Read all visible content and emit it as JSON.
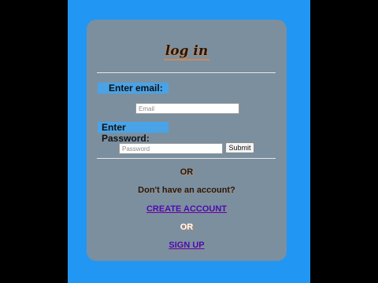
{
  "login_form": {
    "title": "log in",
    "email_label": "Enter email:",
    "email_placeholder": "Email",
    "password_label": "Enter Password:",
    "password_placeholder": "Password",
    "submit_label": "Submit",
    "or_text_1": "OR",
    "no_account_text": "Don't have an account?",
    "create_account_link": "CREATE ACCOUNT",
    "or_text_2": "OR",
    "sign_up_link": "SIGN UP"
  },
  "colors": {
    "page_background": "#2196f3",
    "card_background": "#7b8f9f",
    "label_background": "#4aa3e6",
    "link": "#3a0cc4",
    "shadow_accent": "#c98a5a",
    "letterbox": "#000000"
  }
}
